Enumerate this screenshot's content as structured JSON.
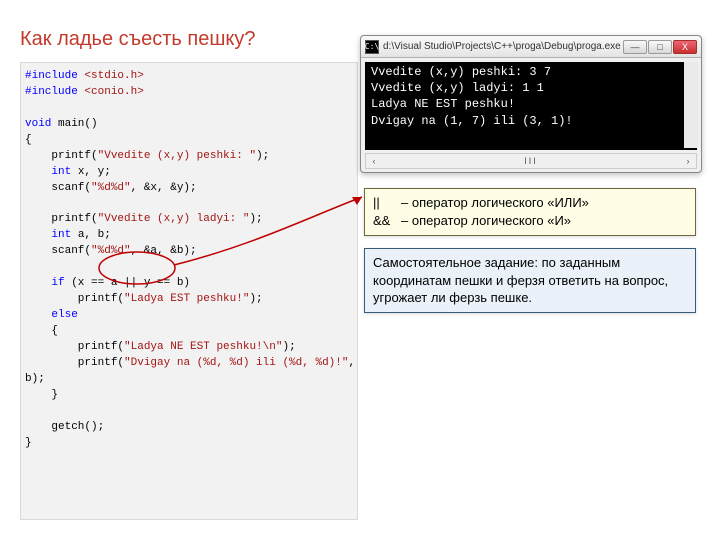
{
  "title": "Как ладье съесть пешку?",
  "code": {
    "l1a": "#include",
    "l1b": " <stdio.h>",
    "l2a": "#include",
    "l2b": " <conio.h>",
    "l3": "",
    "l4a": "void",
    "l4b": " main()",
    "l5": "{",
    "l6a": "    printf(",
    "l6b": "\"Vvedite (x,y) peshki: \"",
    "l6c": ");",
    "l7a": "    ",
    "l7b": "int",
    "l7c": " x, y;",
    "l8a": "    scanf(",
    "l8b": "\"%d%d\"",
    "l8c": ", &x, &y);",
    "l9": "",
    "l10a": "    printf(",
    "l10b": "\"Vvedite (x,y) ladyi: \"",
    "l10c": ");",
    "l11a": "    ",
    "l11b": "int",
    "l11c": " a, b;",
    "l12a": "    scanf(",
    "l12b": "\"%d%d\"",
    "l12c": ", &a, &b);",
    "l13": "",
    "l14a": "    ",
    "l14b": "if",
    "l14c": " (x == a || y == b)",
    "l15a": "        printf(",
    "l15b": "\"Ladya EST peshku!\"",
    "l15c": ");",
    "l16a": "    ",
    "l16b": "else",
    "l17": "    {",
    "l18a": "        printf(",
    "l18b": "\"Ladya NE EST peshku!\\n\"",
    "l18c": ");",
    "l19a": "        printf(",
    "l19b": "\"Dvigay na (%d, %d) ili (%d, %d)!\"",
    "l19c": ", a, y, x, ",
    "l19d": "b);",
    "l20": "    }",
    "l21": "",
    "l22": "    getch();",
    "l23": "}"
  },
  "console": {
    "title": "d:\\Visual Studio\\Projects\\C++\\proga\\Debug\\proga.exe",
    "line1": "Vvedite (x,y) peshki: 3 7",
    "line2": "Vvedite (x,y) ladyi: 1 1",
    "line3": "Ladya NE EST peshku!",
    "line4": "Dvigay na (1, 7) ili (3, 1)!",
    "min": "—",
    "max": "□",
    "close": "X",
    "status_left": "‹",
    "status_mid": "III",
    "status_right": "›"
  },
  "operators": {
    "line1_op": "||",
    "line1_txt": "– оператор логического «ИЛИ»",
    "line2_op": "&&",
    "line2_txt": "– оператор логического «И»"
  },
  "task": {
    "text": "Самостоятельное задание: по заданным координатам пешки и ферзя ответить на вопрос, угрожает ли ферзь пешке."
  }
}
